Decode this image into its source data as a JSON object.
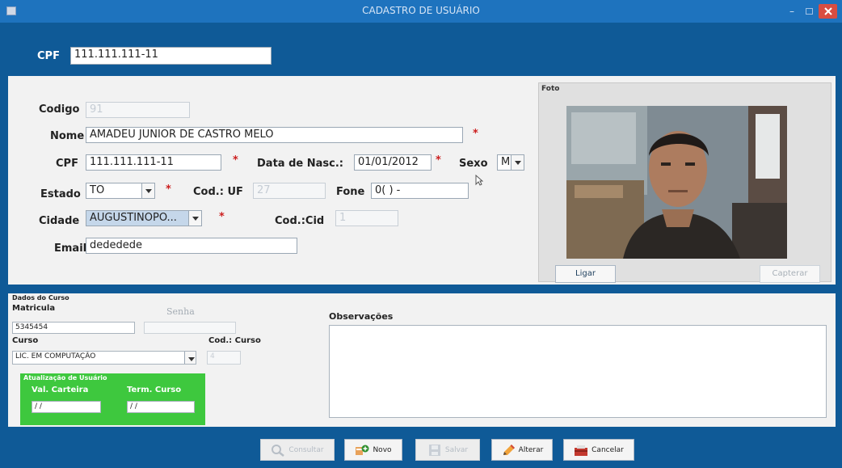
{
  "window": {
    "title": "CADASTRO DE USUÁRIO",
    "minimize": "–"
  },
  "top": {
    "cpf_label": "CPF",
    "cpf_value": "111.111.111-11"
  },
  "form": {
    "codigo_label": "Codigo",
    "codigo_value": "91",
    "nome_label": "Nome",
    "nome_value": "AMADEU JUNIOR DE CASTRO MELO",
    "cpf_label": "CPF",
    "cpf_value": "111.111.111-11",
    "data_nasc_label": "Data de Nasc.:",
    "data_nasc_value": "01/01/2012",
    "sexo_label": "Sexo",
    "sexo_value": "M",
    "estado_label": "Estado",
    "estado_value": "TO",
    "cod_uf_label": "Cod.: UF",
    "cod_uf_value": "27",
    "fone_label": "Fone",
    "fone_value": "0(  )     -",
    "cidade_label": "Cidade",
    "cidade_value": "AUGUSTINOPO...",
    "cod_cid_label": "Cod.:Cid",
    "cod_cid_value": "1",
    "email_label": "Email",
    "email_value": "dededede",
    "required_mark": "*"
  },
  "foto": {
    "label": "Foto",
    "ligar": "Ligar",
    "capturar": "Capterar"
  },
  "curso": {
    "section_title": "Dados do Curso",
    "matricula_label": "Matricula",
    "matricula_value": "5345454",
    "senha_label": "Senha",
    "curso_label": "Curso",
    "curso_value": "LIC. EM COMPUTAÇÃO",
    "cod_curso_label": "Cod.: Curso",
    "cod_curso_value": "4",
    "observacoes_label": "Observações",
    "atualizacao_title": "Atualização de Usuário",
    "val_carteira_label": "Val. Carteira",
    "val_carteira_value": "/ /",
    "term_curso_label": "Term. Curso",
    "term_curso_value": "/ /"
  },
  "buttons": {
    "consultar": "Consultar",
    "novo": "Novo",
    "salvar": "Salvar",
    "alterar": "Alterar",
    "cancelar": "Cancelar"
  },
  "colors": {
    "window_bg": "#0f5a97",
    "titlebar": "#1e73be",
    "panel": "#f2f2f2",
    "required": "#cc1f1f",
    "update_panel": "#3ec83e"
  }
}
